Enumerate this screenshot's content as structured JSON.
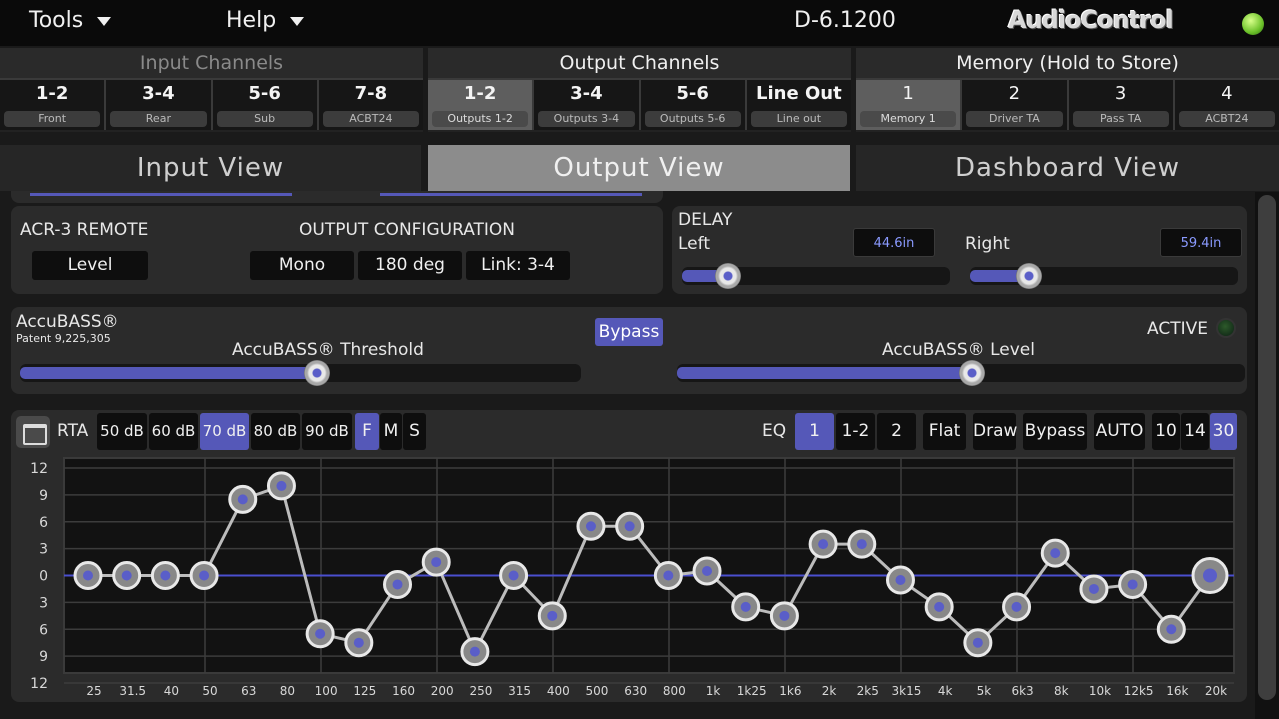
{
  "menu": {
    "tools": "Tools",
    "help": "Help"
  },
  "device": "D-6.1200",
  "brand": "AudioControl",
  "input_channels": {
    "title": "Input Channels",
    "buttons": [
      {
        "label": "1-2",
        "sub": "Front"
      },
      {
        "label": "3-4",
        "sub": "Rear"
      },
      {
        "label": "5-6",
        "sub": "Sub"
      },
      {
        "label": "7-8",
        "sub": "ACBT24"
      }
    ]
  },
  "output_channels": {
    "title": "Output Channels",
    "selected": "1-2",
    "buttons": [
      {
        "label": "1-2",
        "sub": "Outputs 1-2"
      },
      {
        "label": "3-4",
        "sub": "Outputs 3-4"
      },
      {
        "label": "5-6",
        "sub": "Outputs 5-6"
      },
      {
        "label": "Line Out",
        "sub": "Line out"
      }
    ]
  },
  "memory": {
    "title": "Memory (Hold to Store)",
    "selected": "1",
    "buttons": [
      {
        "label": "1",
        "sub": "Memory 1"
      },
      {
        "label": "2",
        "sub": "Driver TA"
      },
      {
        "label": "3",
        "sub": "Pass TA"
      },
      {
        "label": "4",
        "sub": "ACBT24"
      }
    ]
  },
  "views": {
    "input": "Input View",
    "output": "Output View",
    "dashboard": "Dashboard View",
    "active": "output"
  },
  "acr3": {
    "title": "ACR-3 REMOTE",
    "value": "Level"
  },
  "output_config": {
    "title": "OUTPUT CONFIGURATION",
    "mode": "Mono",
    "phase": "180 deg",
    "link": "Link: 3-4"
  },
  "delay": {
    "title": "DELAY",
    "left_label": "Left",
    "left_value": "44.6in",
    "left_level": 0.17,
    "right_label": "Right",
    "right_value": "59.4in",
    "right_level": 0.22
  },
  "accubass": {
    "title": "AccuBASS®",
    "patent": "Patent 9,225,305",
    "bypass": "Bypass",
    "active_label": "ACTIVE",
    "threshold_label": "AccuBASS® Threshold",
    "threshold_level": 0.53,
    "level_label": "AccuBASS® Level",
    "level_level": 0.52
  },
  "rta": {
    "label": "RTA",
    "db_options": [
      "50 dB",
      "60 dB",
      "70 dB",
      "80 dB",
      "90 dB"
    ],
    "db_selected": "70 dB",
    "speed_options": [
      "F",
      "M",
      "S"
    ],
    "speed_selected": "F"
  },
  "eq": {
    "label": "EQ",
    "channel_options": [
      "1",
      "1-2",
      "2"
    ],
    "channel_selected": "1",
    "flat": "Flat",
    "draw": "Draw",
    "bypass": "Bypass",
    "auto": "AUTO",
    "band_options": [
      "10",
      "14",
      "30"
    ],
    "band_selected": "30"
  },
  "colors": {
    "accent": "#5558b8",
    "led_green": "#6cc12a",
    "curve": "#bcbcbc"
  },
  "chart_data": {
    "type": "line",
    "ylim": [
      -12,
      12
    ],
    "y_ticks": [
      "12",
      "9",
      "6",
      "3",
      "0",
      "3",
      "6",
      "9",
      "12"
    ],
    "x": [
      "25",
      "31.5",
      "40",
      "50",
      "63",
      "80",
      "100",
      "125",
      "160",
      "200",
      "250",
      "315",
      "400",
      "500",
      "630",
      "800",
      "1k",
      "1k25",
      "1k6",
      "2k",
      "2k5",
      "3k15",
      "4k",
      "5k",
      "6k3",
      "8k",
      "10k",
      "12k5",
      "16k",
      "20k"
    ],
    "series": [
      {
        "values": [
          0,
          0,
          0,
          0,
          8.5,
          10,
          -6.5,
          -7.5,
          -1,
          1.5,
          -8.5,
          0,
          -4.5,
          5.5,
          5.5,
          0,
          0.5,
          -3.5,
          -4.5,
          3.5,
          3.5,
          -0.5,
          -3.5,
          -7.5,
          -3.5,
          2.5,
          -1.5,
          -1,
          -6,
          0
        ]
      }
    ],
    "grid": true
  }
}
